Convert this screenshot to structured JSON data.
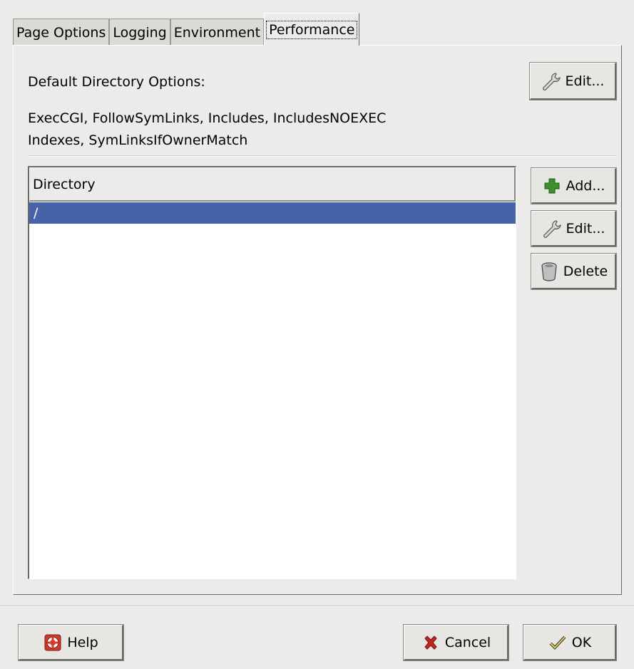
{
  "tabs": [
    {
      "label": "Page Options",
      "active": false
    },
    {
      "label": "Logging",
      "active": false
    },
    {
      "label": "Environment",
      "active": false
    },
    {
      "label": "Performance",
      "active": true
    }
  ],
  "performance": {
    "default_options_label": "Default Directory Options:",
    "options_line1": "ExecCGI, FollowSymLinks, Includes, IncludesNOEXEC",
    "options_line2": "Indexes, SymLinksIfOwnerMatch",
    "edit_default_label": "Edit...",
    "directory_list": {
      "column_header": "Directory",
      "rows": [
        "/"
      ],
      "selected_index": 0
    },
    "buttons": {
      "add": "Add...",
      "edit": "Edit...",
      "delete": "Delete"
    }
  },
  "footer": {
    "help": "Help",
    "cancel": "Cancel",
    "ok": "OK"
  },
  "icons": {
    "edit": "wrench-icon",
    "add": "plus-icon",
    "delete": "trash-icon",
    "help": "lifebuoy-icon",
    "cancel": "x-icon",
    "ok": "checkmark-icon"
  },
  "colors": {
    "selection": "#4563a6",
    "dialog_bg": "#ecebe9",
    "add_green": "#3f8f2f",
    "cancel_red": "#c4271d"
  }
}
